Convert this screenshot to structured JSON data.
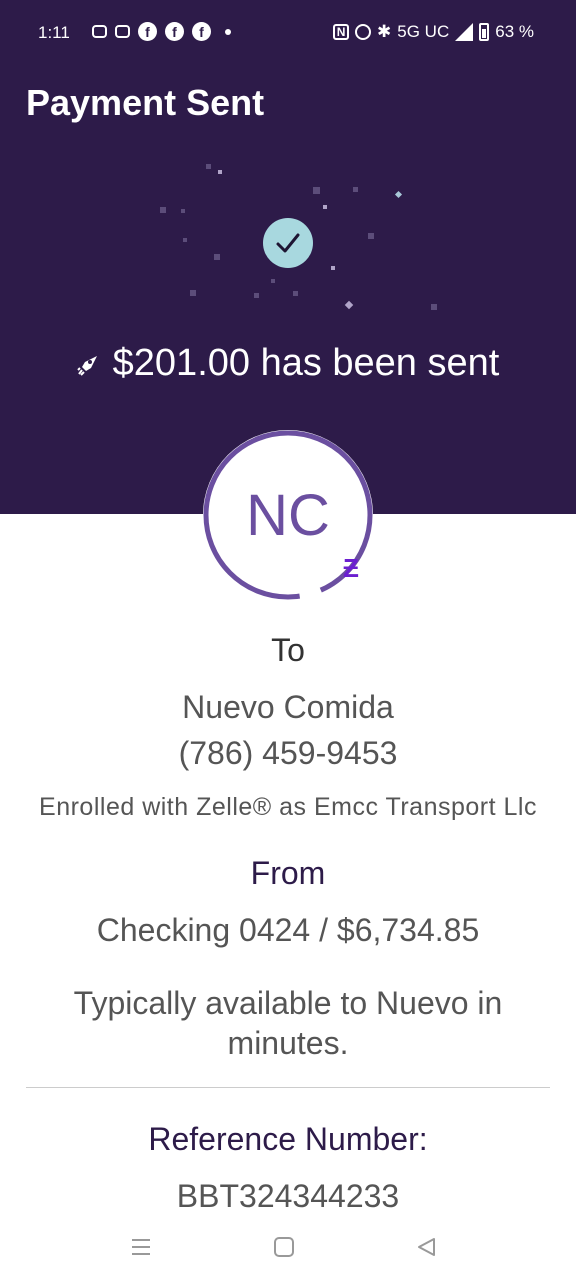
{
  "status_bar": {
    "time": "1:11",
    "network": "5G UC",
    "battery": "63 %"
  },
  "header": {
    "title": "Payment Sent",
    "sent_message": "$201.00 has been sent",
    "background_color": "#2d1b49"
  },
  "recipient": {
    "initials": "NC",
    "to_label": "To",
    "name": "Nuevo Comida",
    "phone": "(786) 459-9453",
    "enrolled_text": "Enrolled with Zelle® as Emcc Transport Llc",
    "badge_icon": "zelle-z-icon"
  },
  "source": {
    "from_label": "From",
    "account": "Checking 0424 / $6,734.85"
  },
  "availability_text": "Typically available to Nuevo in minutes.",
  "reference": {
    "label": "Reference Number:",
    "value": "BBT324344233"
  },
  "navigation": {
    "recents_icon": "menu-lines-icon",
    "home_icon": "square-home-icon",
    "back_icon": "triangle-back-icon"
  },
  "colors": {
    "accent": "#6b4fa0",
    "check_circle": "#a8d8df",
    "zelle_purple": "#6b1fd0"
  }
}
